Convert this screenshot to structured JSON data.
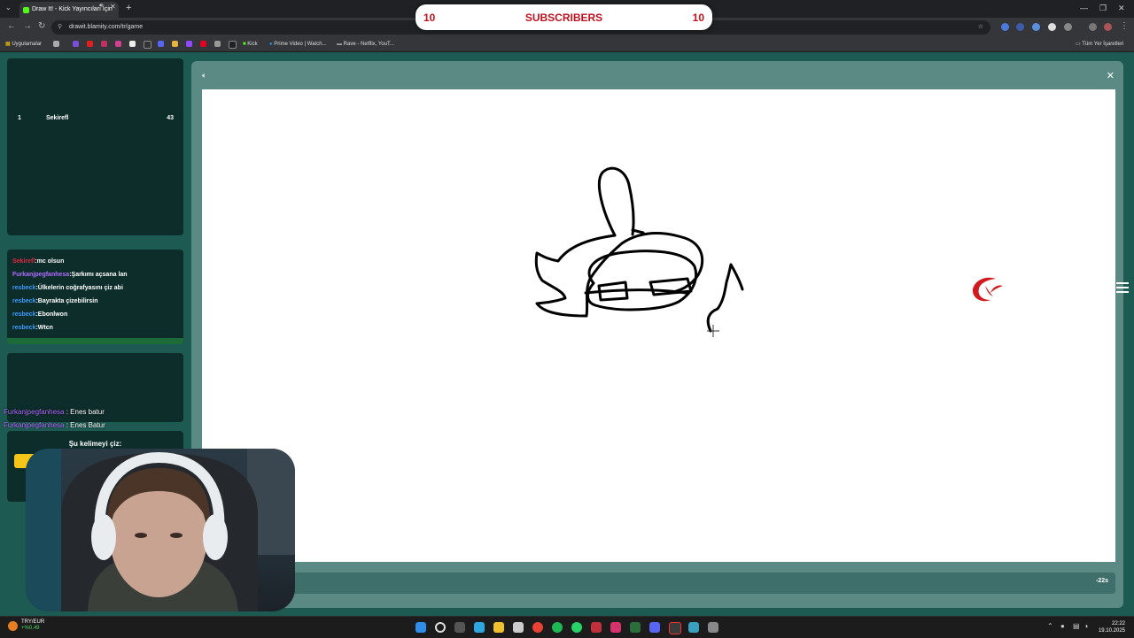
{
  "browser": {
    "tab_title": "Draw It! - Kick Yayıncıları İçin",
    "url": "drawit.blamity.com/tr/game",
    "bookmarks": [
      "Uygulamalar",
      "Kick",
      "Prime Video | Watch...",
      "Rave - Netflix, YouT...",
      "Tüm Yer İşaretleri"
    ]
  },
  "overlay": {
    "left_count": "10",
    "label": "SUBSCRIBERS",
    "right_count": "10"
  },
  "leaderboard": {
    "rows": [
      {
        "rank": "1",
        "name": "Sekirefl",
        "score": "43"
      }
    ]
  },
  "chat": {
    "messages": [
      {
        "user": "Sekirefl",
        "text": ":mc olsun",
        "color": "#e0283e"
      },
      {
        "user": "Furkanjpegfanhesa",
        "text": ":Şarkımı açsana lan",
        "color": "#b06cff"
      },
      {
        "user": "resbeck",
        "text": ":Ülkelerin coğrafyasını çiz abi",
        "color": "#3b9cff"
      },
      {
        "user": "resbeck",
        "text": ":Bayrakta çizebilirsin",
        "color": "#3b9cff"
      },
      {
        "user": "resbeck",
        "text": ":Ebonlwon",
        "color": "#3b9cff"
      },
      {
        "user": "resbeck",
        "text": ":Wtcn",
        "color": "#3b9cff"
      }
    ]
  },
  "stream_chat": [
    {
      "user": "Furkanjpegfanhesa",
      "text": " : Enes batur"
    },
    {
      "user": "Furkanjpegfanhesa",
      "text": " : Enes Batur"
    }
  ],
  "word_prompt": "Şu kelimeyi çiz:",
  "timer": "-22s",
  "taskbar": {
    "stock_name": "TRY/EUR",
    "stock_change": "+%0,49",
    "time": "22:22",
    "date": "19.10.2025"
  },
  "colors": {
    "page_bg": "#1d5a52",
    "panel_bg": "#5b8a85",
    "overlay_text": "#c0101e",
    "word_button": "#f5c518"
  }
}
